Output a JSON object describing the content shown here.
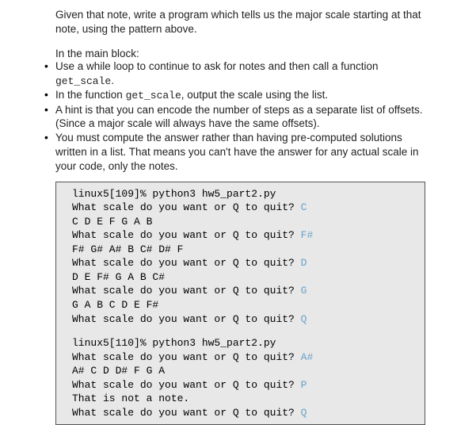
{
  "intro": "Given that note, write a program which tells us the major scale starting at that note, using the pattern above.",
  "list_heading": "In the main block:",
  "bullets": {
    "b1a": "Use a while loop to continue to ask for notes and then call a function ",
    "b1b": "get_scale",
    "b1c": ".",
    "b2a": "In the function ",
    "b2b": "get_scale",
    "b2c": ", output the scale using the list.",
    "b3": "A hint is that you can encode the number of steps as a separate list of offsets.  (Since a major scale will always have the same offsets).",
    "b4": "You must compute the answer rather than having pre-computed solutions written in a list.  That means you can't have the answer for any actual scale in your code, only the notes."
  },
  "terminal": {
    "run1_cmd": "linux5[109]% python3 hw5_part2.py",
    "prompt": "What scale do you want or Q to quit? ",
    "in1": "C",
    "out1": "C D E F G A B",
    "in2": "F#",
    "out2": "F# G# A# B C# D# F",
    "in3": "D",
    "out3": "D E F# G A B C#",
    "in4": "G",
    "out4": "G A B C D E F#",
    "in5": "Q",
    "run2_cmd": "linux5[110]% python3 hw5_part2.py",
    "in6": "A#",
    "out6": "A# C D D# F G A",
    "in7": "P",
    "err": "That is not a note.",
    "in8": "Q"
  }
}
